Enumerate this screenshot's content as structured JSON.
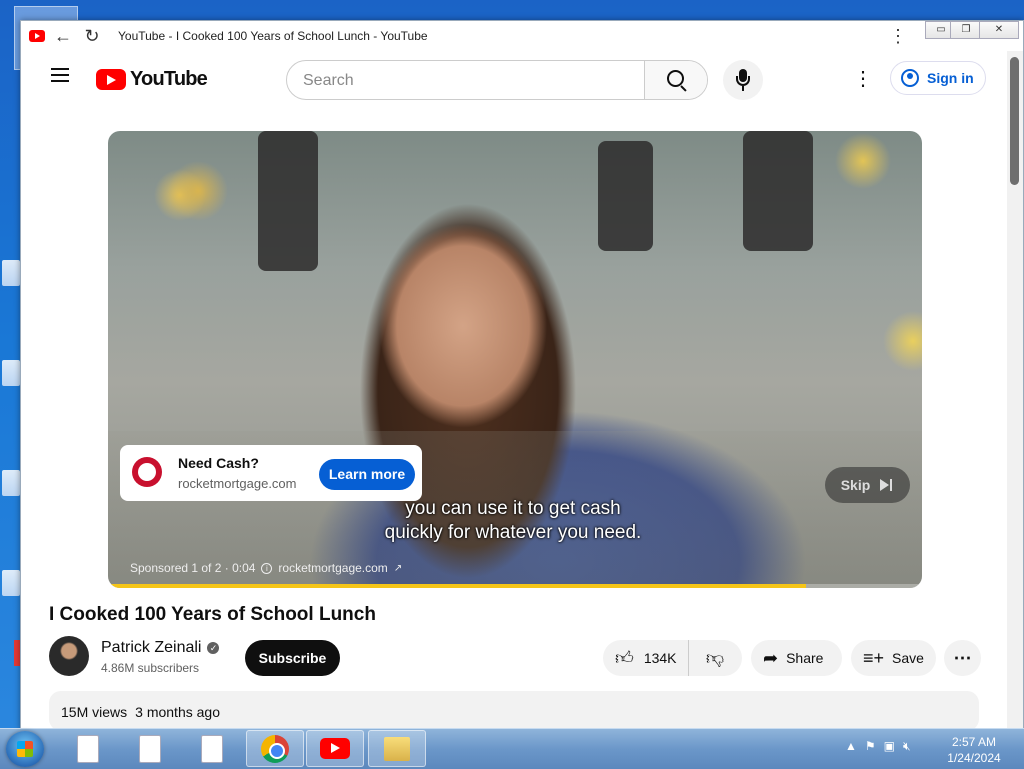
{
  "browser": {
    "tab_title": "YouTube - I Cooked 100 Years of School Lunch - YouTube",
    "window_controls": {
      "minimize": "▭",
      "restore": "❐",
      "close": "✕"
    }
  },
  "youtube": {
    "logo_text": "YouTube",
    "search_placeholder": "Search",
    "sign_in_label": "Sign in"
  },
  "ad": {
    "title": "Need Cash?",
    "domain": "rocketmortgage.com",
    "cta": "Learn more",
    "skip_label": "Skip",
    "caption_line1": "you can use it to get cash",
    "caption_line2": "quickly for whatever you need.",
    "sponsored": "Sponsored 1 of 2 · 0:04",
    "meta_domain": "rocketmortgage.com",
    "progress": 0.857
  },
  "video": {
    "title": "I Cooked 100 Years of School Lunch",
    "channel_name": "Patrick Zeinali",
    "subscribers": "4.86M subscribers",
    "subscribe_label": "Subscribe",
    "likes": "134K",
    "share_label": "Share",
    "save_label": "Save",
    "views": "15M views",
    "age": "3 months ago"
  },
  "taskbar": {
    "time": "2:57 AM",
    "date": "1/24/2024"
  },
  "colors": {
    "youtube_red": "#ff0000",
    "link_blue": "#065fd4",
    "progress_yellow": "#f5c518"
  }
}
